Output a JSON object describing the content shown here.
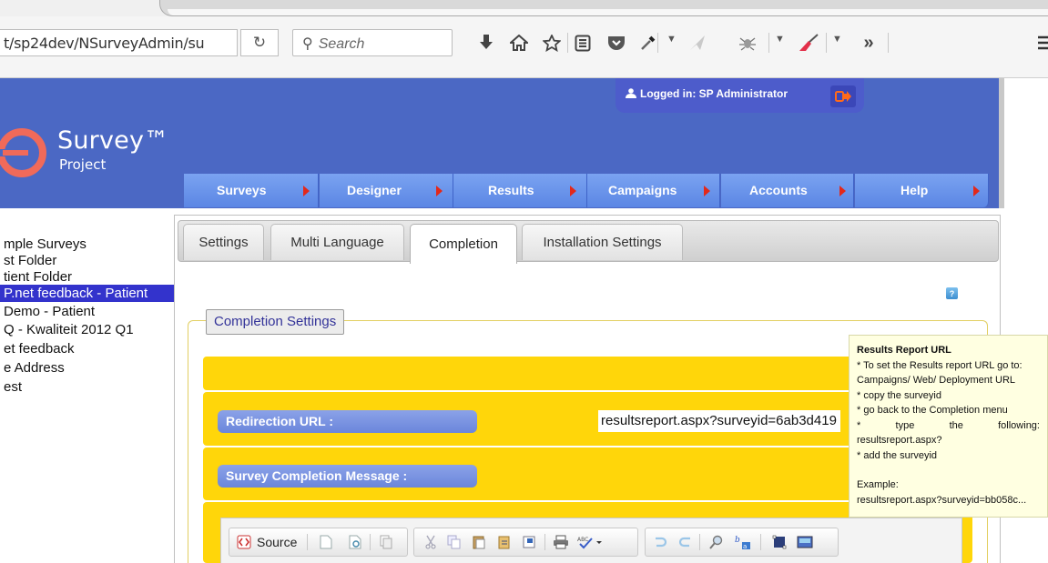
{
  "browser": {
    "url_text": "t/sp24dev/NSurveyAdmin/su",
    "search_placeholder": "Search",
    "overflow_label": "»"
  },
  "header": {
    "login_text": "Logged in: SP Administrator",
    "logo_title": "Survey™",
    "logo_subtitle": "Project"
  },
  "nav": [
    {
      "label": "Surveys"
    },
    {
      "label": "Designer"
    },
    {
      "label": "Results"
    },
    {
      "label": "Campaigns"
    },
    {
      "label": "Accounts"
    },
    {
      "label": "Help"
    }
  ],
  "sidebar": {
    "items": [
      {
        "label": "mple Surveys"
      },
      {
        "label": "st Folder"
      },
      {
        "label": "tient Folder"
      },
      {
        "label": "P.net feedback - Patient",
        "selected": true
      },
      {
        "label": " Demo - Patient"
      },
      {
        "label": "Q - Kwaliteit 2012 Q1"
      },
      {
        "label": "et feedback"
      },
      {
        "label": "e Address"
      },
      {
        "label": "est"
      }
    ]
  },
  "tabs": [
    {
      "label": "Settings"
    },
    {
      "label": "Multi Language"
    },
    {
      "label": "Completion",
      "active": true
    },
    {
      "label": "Installation Settings"
    }
  ],
  "completion": {
    "legend": "Completion Settings",
    "help_icon_text": "?",
    "redirect_label": "Redirection URL :",
    "redirect_value": "resultsreport.aspx?surveyid=6ab3d419",
    "message_label": "Survey Completion Message :",
    "editor_source_label": "Source"
  },
  "tooltip": {
    "title": "Results Report URL",
    "line1": "* To set the Results report URL go to:",
    "line2": "Campaigns/ Web/ Deployment URL",
    "line3": "* copy the surveyid",
    "line4": "* go back to the Completion menu",
    "line5_a": "*",
    "line5_b": "type",
    "line5_c": "the",
    "line5_d": "following:",
    "line6": "resultsreport.aspx?",
    "line7": "* add the surveyid",
    "line8": "Example:",
    "line9": "resultsreport.aspx?surveyid=bb058c..."
  },
  "colors": {
    "header_blue": "#4b68c4",
    "nav_blue": "#6a93ea",
    "nav_arrow": "#e3281a",
    "selected_row": "#3333cc",
    "yellow_band": "#ffd60a",
    "tooltip_bg": "#ffffe1"
  }
}
